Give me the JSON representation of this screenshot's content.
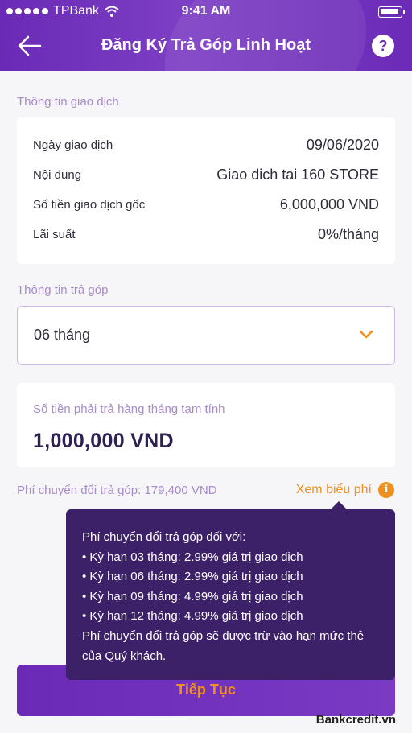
{
  "status_bar": {
    "carrier": "TPBank",
    "time": "9:41 AM"
  },
  "header": {
    "title": "Đăng Ký Trả Góp Linh Hoạt",
    "help_label": "?"
  },
  "transaction": {
    "section_label": "Thông tin giao dịch",
    "rows": [
      {
        "label": "Ngày giao dịch",
        "value": "09/06/2020"
      },
      {
        "label": "Nội dung",
        "value": "Giao dich tai 160 STORE"
      },
      {
        "label": "Số tiền giao dịch gốc",
        "value": "6,000,000 VND"
      },
      {
        "label": "Lãi suất",
        "value": "0%/tháng"
      }
    ]
  },
  "installment": {
    "section_label": "Thông tin trả góp",
    "selected_term": "06 tháng",
    "monthly_label": "Số tiền phải trả hàng tháng tạm tính",
    "monthly_value": "1,000,000 VND",
    "fee_line": "Phí chuyển đổi trả góp: 179,400 VND",
    "fee_link": "Xem biểu phí",
    "info_icon": "i"
  },
  "tooltip": {
    "lines": [
      "Phí chuyển đổi trả góp đối với:",
      "• Kỳ hạn 03 tháng: 2.99% giá trị giao dịch",
      "• Kỳ hạn 06 tháng: 2.99% giá trị giao dịch",
      "• Kỳ hạn 09 tháng: 4.99% giá trị giao dịch",
      "• Kỳ hạn 12 tháng: 4.99% giá trị giao dịch",
      "Phí chuyển đổi trả góp sẽ được trừ vào hạn mức thẻ",
      "của Quý khách."
    ]
  },
  "cta": {
    "label": "Tiếp Tục"
  },
  "watermark": "Bankcredit.vn",
  "colors": {
    "primary": "#6a2ab6",
    "accent": "#f0901e",
    "tooltip_bg": "#3d2168",
    "muted_label": "#a88bc9"
  },
  "icons": {
    "back": "arrow-left-icon",
    "help": "question-icon",
    "chevron": "chevron-down-icon",
    "info": "info-icon",
    "wifi": "wifi-icon",
    "battery": "battery-icon"
  }
}
